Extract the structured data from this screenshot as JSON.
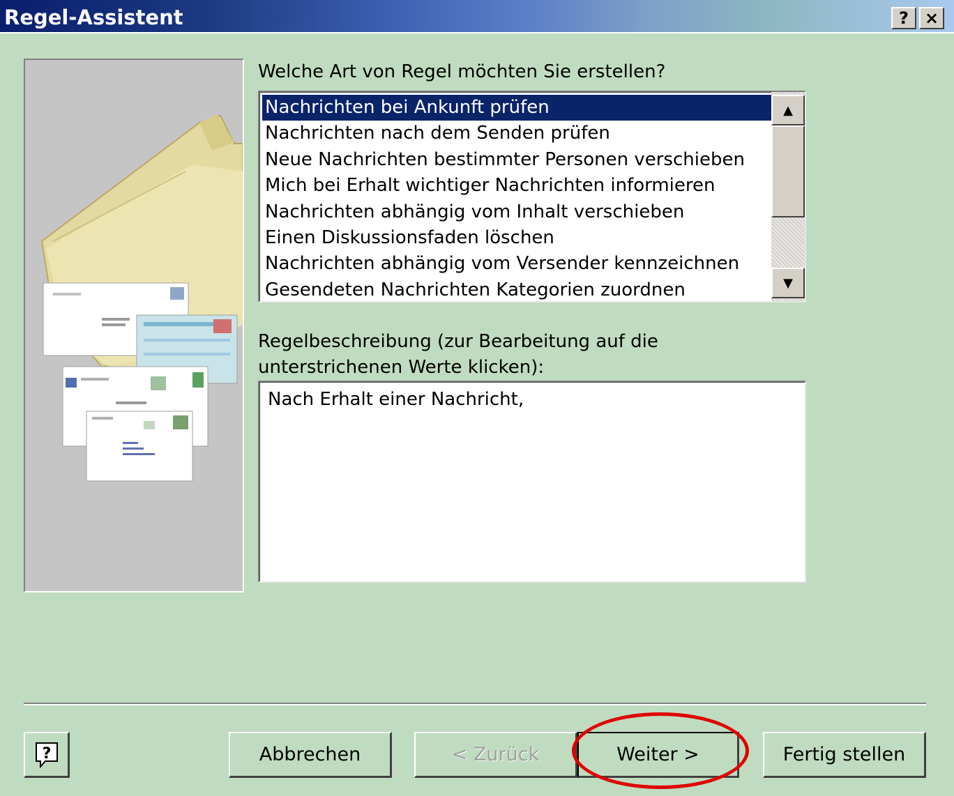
{
  "window": {
    "title": "Regel-Assistent",
    "help_button": "?",
    "close_button": "×"
  },
  "question_label": "Welche Art von Regel möchten Sie erstellen?",
  "rule_list": {
    "selected_index": 0,
    "items": [
      "Nachrichten bei Ankunft prüfen",
      "Nachrichten nach dem Senden prüfen",
      "Neue Nachrichten bestimmter Personen verschieben",
      "Mich bei Erhalt wichtiger Nachrichten informieren",
      "Nachrichten abhängig vom Inhalt verschieben",
      "Einen Diskussionsfaden löschen",
      "Nachrichten abhängig vom Versender kennzeichnen",
      "Gesendeten Nachrichten Kategorien zuordnen"
    ]
  },
  "description": {
    "label_line1": "Regelbeschreibung (zur Bearbeitung auf die",
    "label_line2": "unterstrichenen Werte klicken):",
    "text": "Nach Erhalt einer Nachricht,"
  },
  "buttons": {
    "cancel": "Abbrechen",
    "back": "< Zurück",
    "next": "Weiter >",
    "finish": "Fertig stellen"
  },
  "colors": {
    "dialog_background": "#c0dcc0",
    "selection": "#0a246a",
    "highlight_annotation": "#e00000"
  }
}
